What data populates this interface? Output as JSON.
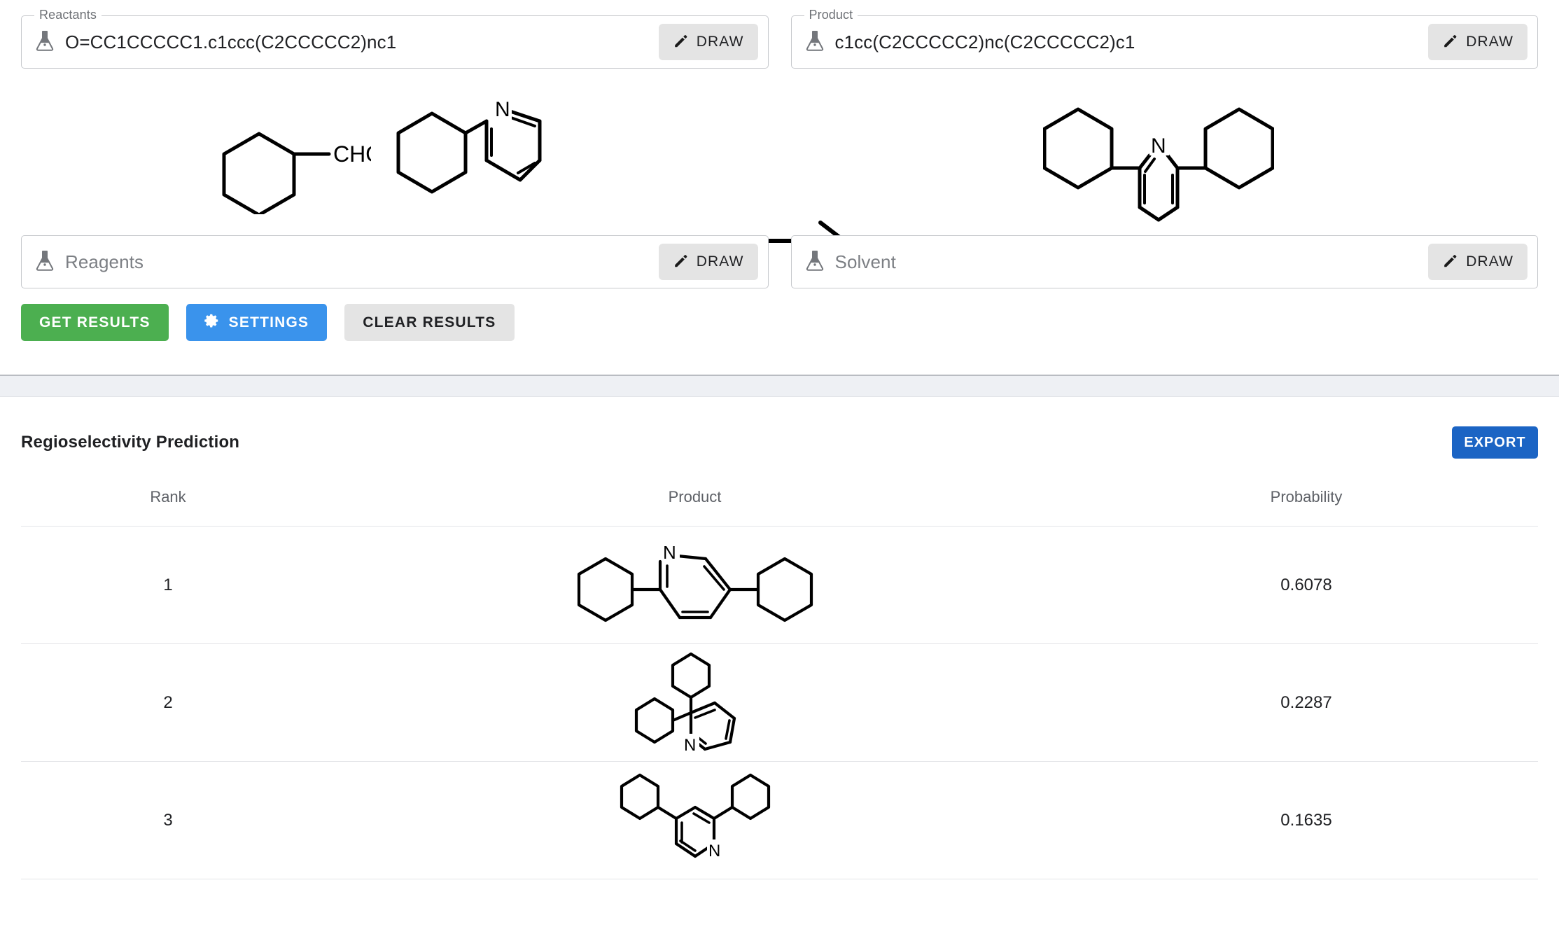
{
  "form": {
    "reactants": {
      "legend": "Reactants",
      "value": "O=CC1CCCCC1.c1ccc(C2CCCCC2)nc1",
      "placeholder": "Reactants",
      "draw_label": "DRAW"
    },
    "product": {
      "legend": "Product",
      "value": "c1cc(C2CCCCC2)nc(C2CCCCC2)c1",
      "placeholder": "Product",
      "draw_label": "DRAW"
    },
    "reagents": {
      "legend": "",
      "value": "",
      "placeholder": "Reagents",
      "draw_label": "DRAW"
    },
    "solvent": {
      "legend": "",
      "value": "",
      "placeholder": "Solvent",
      "draw_label": "DRAW"
    }
  },
  "scheme": {
    "reactant_1_label": "CHO",
    "reactant_2_label": "N",
    "product_label": "N"
  },
  "actions": {
    "get_results": "GET RESULTS",
    "settings": "SETTINGS",
    "clear_results": "CLEAR RESULTS"
  },
  "results": {
    "title": "Regioselectivity Prediction",
    "export_label": "EXPORT",
    "columns": [
      "Rank",
      "Product",
      "Probability"
    ],
    "rows": [
      {
        "rank": "1",
        "probability": "0.6078",
        "atom_label": "N",
        "structure": "2,5-dicyclohexylpyridine"
      },
      {
        "rank": "2",
        "probability": "0.2287",
        "atom_label": "N",
        "structure": "2,3-dicyclohexylpyridine"
      },
      {
        "rank": "3",
        "probability": "0.1635",
        "atom_label": "N",
        "structure": "2,4-dicyclohexylpyridine"
      }
    ]
  },
  "colors": {
    "primary_green": "#4caf50",
    "primary_blue": "#3a93ec",
    "export_blue": "#1b64c4",
    "neutral_gray": "#e4e4e4",
    "band_gray": "#eef0f4"
  }
}
